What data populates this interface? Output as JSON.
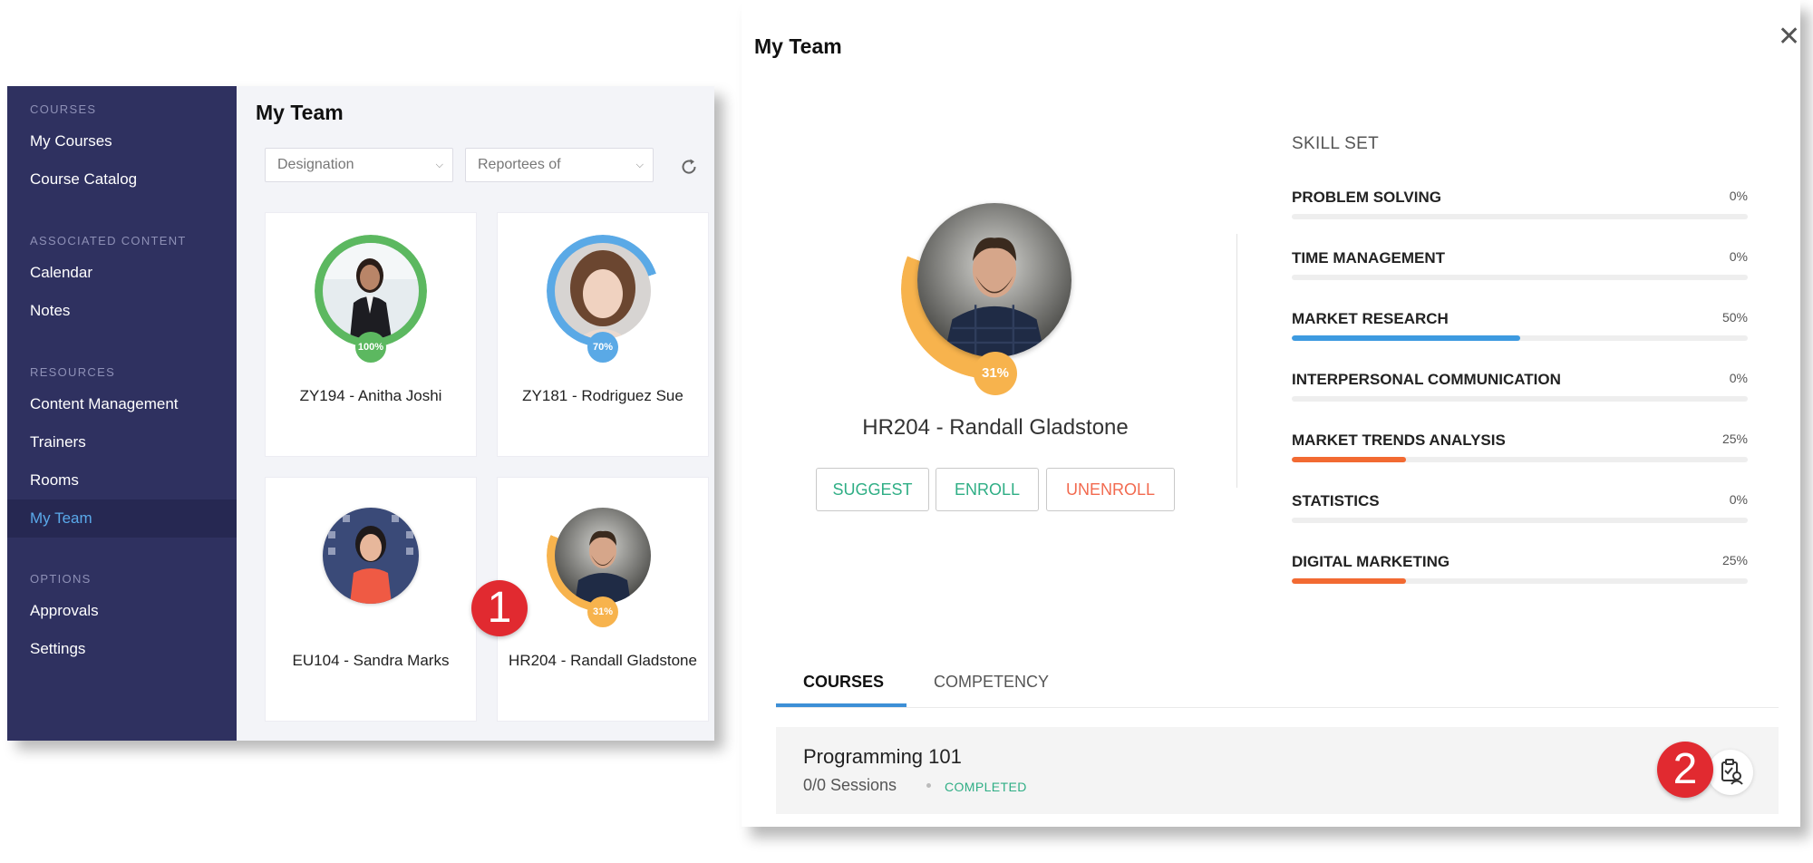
{
  "sidebar": {
    "sections": [
      {
        "title": "COURSES",
        "items": [
          {
            "label": "My Courses"
          },
          {
            "label": "Course Catalog"
          }
        ]
      },
      {
        "title": "ASSOCIATED CONTENT",
        "items": [
          {
            "label": "Calendar"
          },
          {
            "label": "Notes"
          }
        ]
      },
      {
        "title": "RESOURCES",
        "items": [
          {
            "label": "Content Management"
          },
          {
            "label": "Trainers"
          },
          {
            "label": "Rooms"
          },
          {
            "label": "My Team"
          }
        ]
      },
      {
        "title": "OPTIONS",
        "items": [
          {
            "label": "Approvals"
          },
          {
            "label": "Settings"
          }
        ]
      }
    ],
    "active_item": "My Team"
  },
  "team_view": {
    "title": "My Team",
    "filters": {
      "designation": "Designation",
      "reportees": "Reportees of"
    },
    "members": [
      {
        "name": "ZY194 - Anitha Joshi",
        "progress": "100%",
        "progress_value": 100,
        "color": "#5cb860",
        "avatar": "woman-in-black-suit"
      },
      {
        "name": "ZY181 - Rodriguez Sue",
        "progress": "70%",
        "progress_value": 70,
        "color": "#5aa9e6",
        "avatar": "woman-with-brown-hair"
      },
      {
        "name": "EU104 - Sandra Marks",
        "progress": "",
        "progress_value": 0,
        "color": "#cccccc",
        "avatar": "woman-in-red-top"
      },
      {
        "name": "HR204 - Randall Gladstone",
        "progress": "31%",
        "progress_value": 31,
        "color": "#f7b34d",
        "avatar": "man-in-plaid-shirt"
      }
    ]
  },
  "callouts": {
    "one": "1",
    "two": "2"
  },
  "detail": {
    "title": "My Team",
    "close_icon": "close-icon",
    "profile": {
      "name": "HR204 - Randall Gladstone",
      "progress": "31%",
      "progress_value": 31,
      "ring_color": "#f7b34d"
    },
    "actions": {
      "suggest": "SUGGEST",
      "enroll": "ENROLL",
      "unenroll": "UNENROLL"
    },
    "skill_set": {
      "heading": "SKILL SET",
      "skills": [
        {
          "name": "PROBLEM SOLVING",
          "value": "0%",
          "fraction": 0,
          "color": "#3d9ae0"
        },
        {
          "name": "TIME MANAGEMENT",
          "value": "0%",
          "fraction": 0,
          "color": "#3d9ae0"
        },
        {
          "name": "MARKET RESEARCH",
          "value": "50%",
          "fraction": 0.5,
          "color": "#3d9ae0"
        },
        {
          "name": "INTERPERSONAL COMMUNICATION",
          "value": "0%",
          "fraction": 0,
          "color": "#3d9ae0"
        },
        {
          "name": "MARKET TRENDS ANALYSIS",
          "value": "25%",
          "fraction": 0.25,
          "color": "#f26a32"
        },
        {
          "name": "STATISTICS",
          "value": "0%",
          "fraction": 0,
          "color": "#f26a32"
        },
        {
          "name": "DIGITAL MARKETING",
          "value": "25%",
          "fraction": 0.25,
          "color": "#f26a32"
        }
      ]
    },
    "tabs": [
      {
        "label": "COURSES",
        "active": true
      },
      {
        "label": "COMPETENCY",
        "active": false
      }
    ],
    "course": {
      "title": "Programming 101",
      "sessions": "0/0 Sessions",
      "status": "COMPLETED",
      "icon": "clipboard-user-icon"
    }
  }
}
